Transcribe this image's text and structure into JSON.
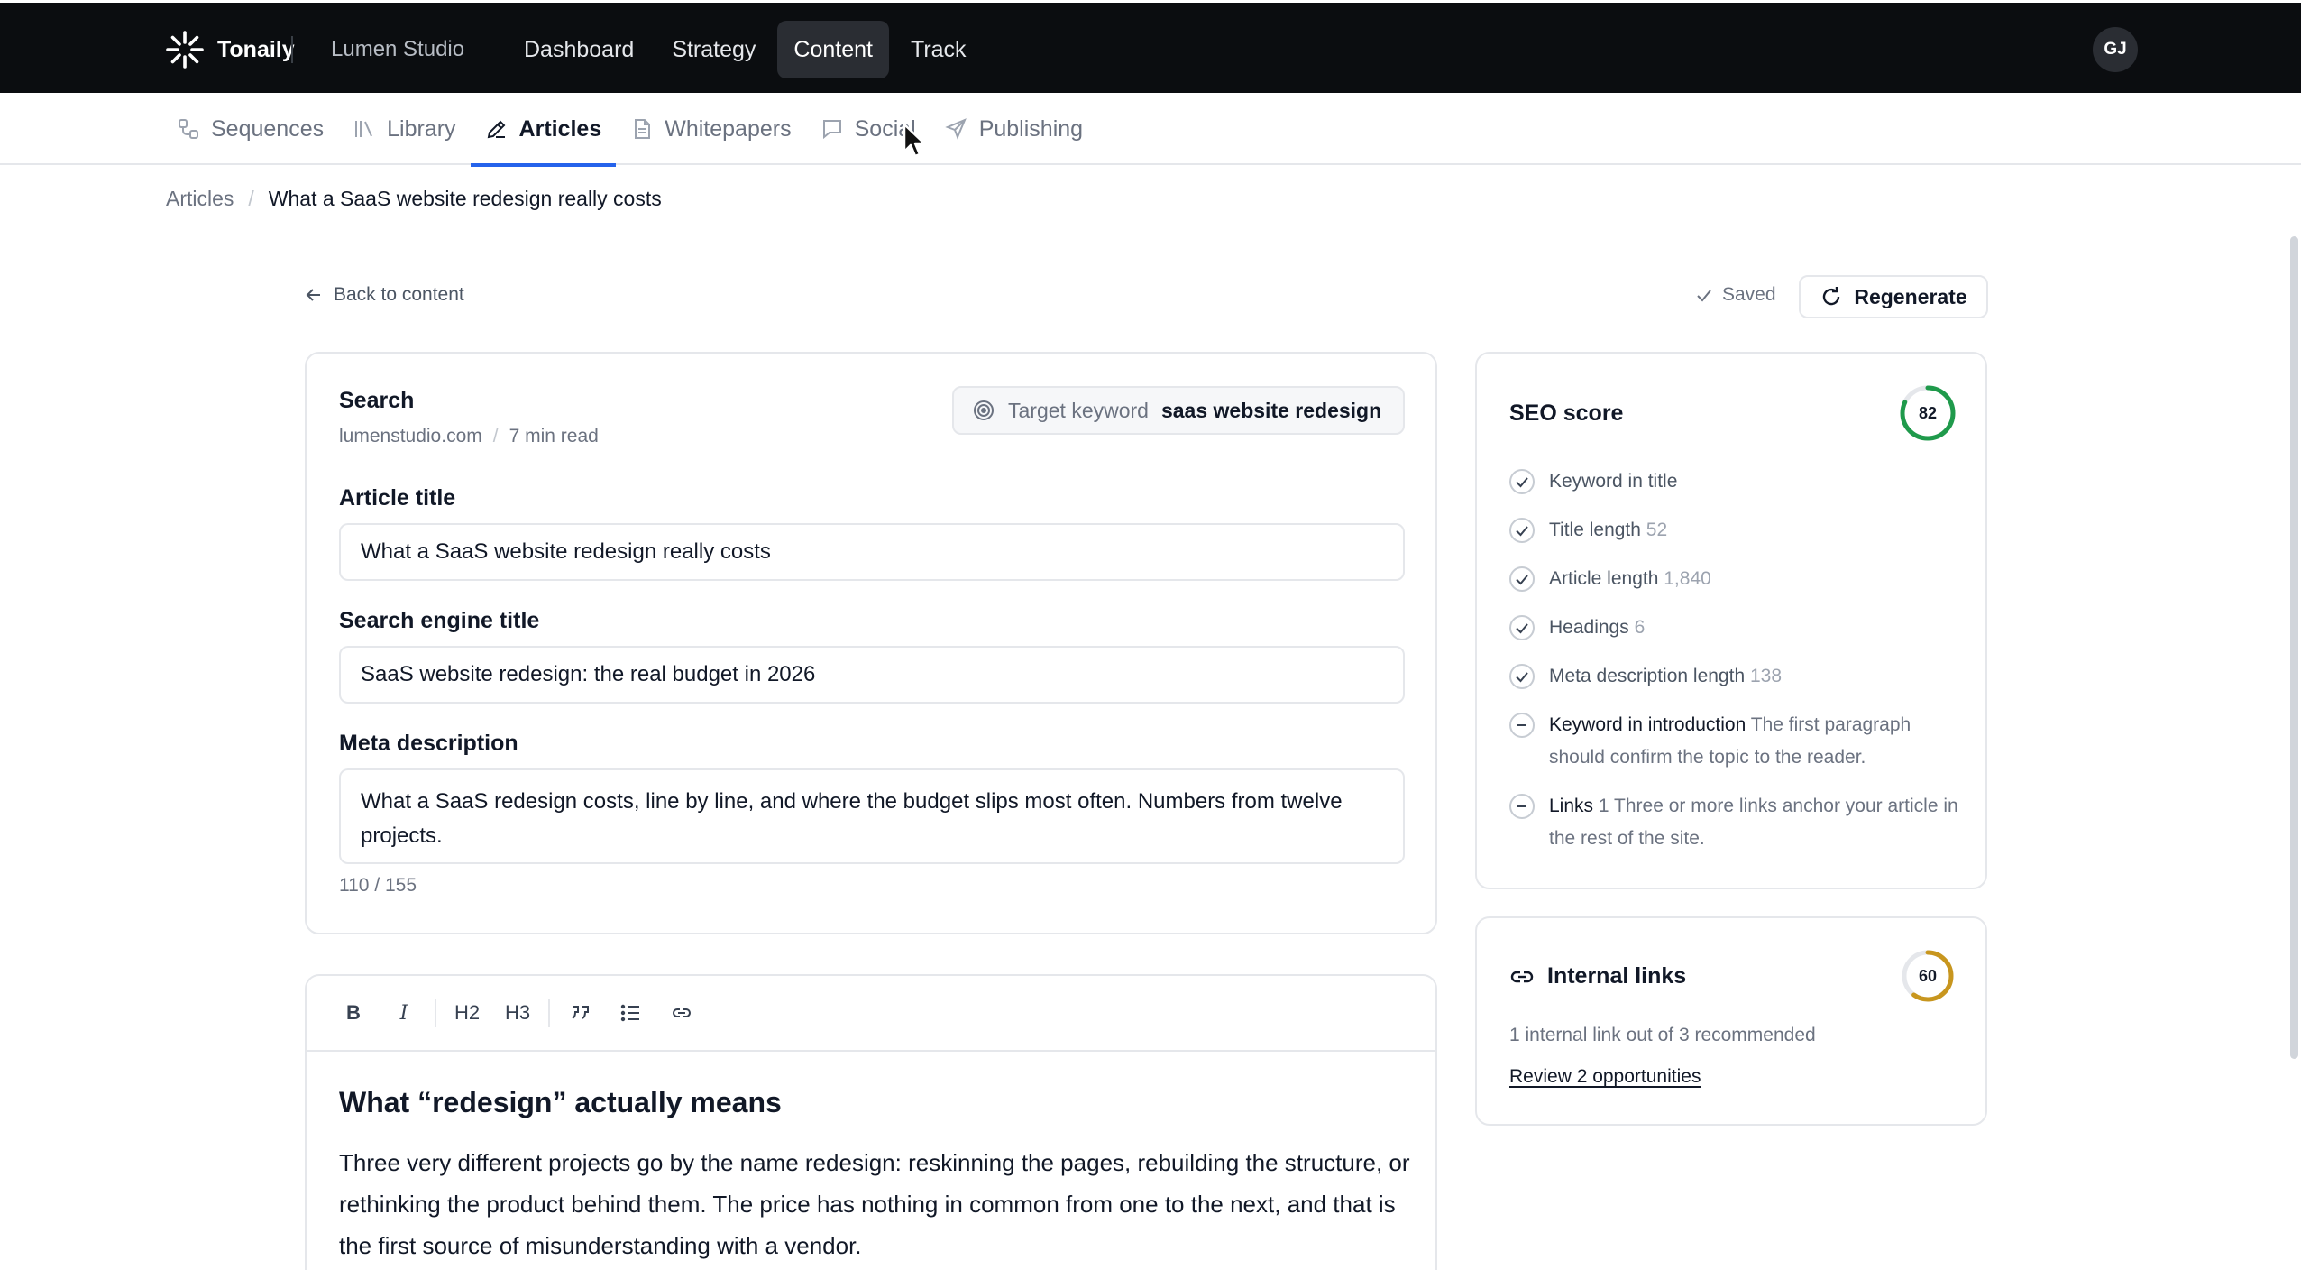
{
  "app": {
    "brand": "Tonaily",
    "workspace": "Lumen Studio",
    "user_initials": "GJ"
  },
  "main_nav": [
    {
      "label": "Dashboard",
      "active": false
    },
    {
      "label": "Strategy",
      "active": false
    },
    {
      "label": "Content",
      "active": true
    },
    {
      "label": "Track",
      "active": false
    }
  ],
  "sub_nav": [
    {
      "label": "Sequences",
      "icon": "sequences-icon",
      "active": false
    },
    {
      "label": "Library",
      "icon": "library-icon",
      "active": false
    },
    {
      "label": "Articles",
      "icon": "pencil-icon",
      "active": true
    },
    {
      "label": "Whitepapers",
      "icon": "document-icon",
      "active": false
    },
    {
      "label": "Social",
      "icon": "chat-icon",
      "active": false
    },
    {
      "label": "Publishing",
      "icon": "send-icon",
      "active": false
    }
  ],
  "breadcrumb": {
    "parent": "Articles",
    "current": "What a SaaS website redesign really costs"
  },
  "actions": {
    "back": "Back to content",
    "saved": "Saved",
    "regenerate": "Regenerate"
  },
  "meta": {
    "source_type": "Search",
    "domain": "lumenstudio.com",
    "read_time": "7 min read",
    "keyword_label": "Target keyword",
    "keyword_value": "saas website redesign",
    "article_title_label": "Article title",
    "article_title_value": "What a SaaS website redesign really costs",
    "seo_title_label": "Search engine title",
    "seo_title_value": "SaaS website redesign: the real budget in 2026",
    "meta_desc_label": "Meta description",
    "meta_desc_value": "What a SaaS redesign costs, line by line, and where the budget slips most often. Numbers from twelve projects.",
    "char_count": "110 / 155"
  },
  "editor": {
    "toolbar": {
      "bold": "B",
      "italic": "I",
      "h2": "H2",
      "h3": "H3"
    },
    "heading": "What “redesign” actually means",
    "paragraph": "Three very different projects go by the name redesign: reskinning the pages, rebuilding the structure, or rethinking the product behind them. The price has nothing in common from one to the next, and that is the first source of misunderstanding with a vendor."
  },
  "seo": {
    "title": "SEO score",
    "score": 82,
    "score_fraction": 0.82,
    "score_color": "#1f9a4b",
    "checks": [
      {
        "label": "Keyword in title",
        "value": "",
        "note": "",
        "status": "pass"
      },
      {
        "label": "Title length",
        "value": "52",
        "note": "",
        "status": "pass"
      },
      {
        "label": "Article length",
        "value": "1,840",
        "note": "",
        "status": "pass"
      },
      {
        "label": "Headings",
        "value": "6",
        "note": "",
        "status": "pass"
      },
      {
        "label": "Meta description length",
        "value": "138",
        "note": "",
        "status": "pass"
      },
      {
        "label": "Keyword in introduction",
        "value": "",
        "note": "The first paragraph should confirm the topic to the reader.",
        "status": "warn"
      },
      {
        "label": "Links",
        "value": "1",
        "note": "Three or more links anchor your article in the rest of the site.",
        "status": "warn"
      }
    ]
  },
  "internal_links": {
    "title": "Internal links",
    "score": 60,
    "score_fraction": 0.6,
    "score_color": "#c8961e",
    "summary": "1 internal link out of 3 recommended",
    "cta": "Review 2 opportunities"
  }
}
